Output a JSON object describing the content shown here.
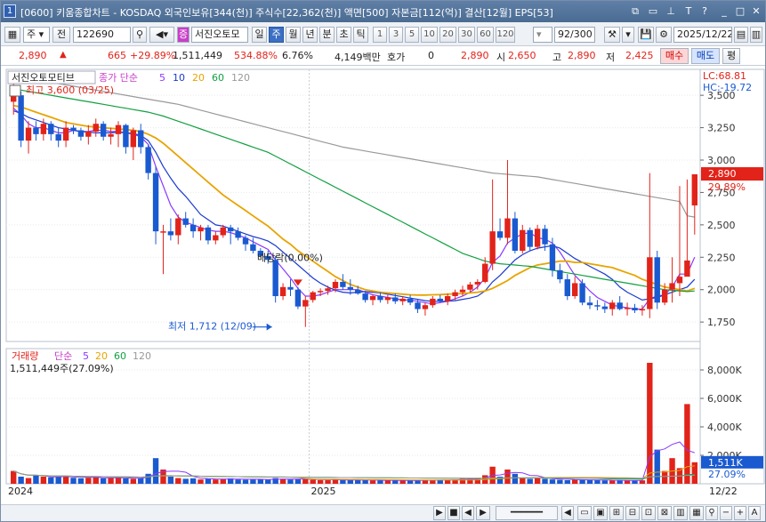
{
  "window": {
    "number": "1",
    "title": "[0600] 키움종합차트 - KOSDAQ 외국인보유[344(천)] 주식수[22,362(천)] 액면[500] 자본금[112(억)] 결산[12월] EPS[53]"
  },
  "toolbar": {
    "type_select": "주",
    "prev_label": "전",
    "code": "122690",
    "name": "서진오토모",
    "period_buttons": [
      "일",
      "주",
      "월",
      "년",
      "분",
      "초",
      "틱"
    ],
    "selected_period": "주",
    "num_buttons": [
      "1",
      "3",
      "5",
      "10",
      "20",
      "30",
      "60",
      "120"
    ],
    "count": "92/300",
    "date": "2025/12/22"
  },
  "pricebar": {
    "price": "2,890",
    "change": "665",
    "change_pct": "+29.89%",
    "volume": "1,511,449",
    "vol_pct": "534.88%",
    "turnover": "6.76%",
    "amount": "4,149백만",
    "quote_label": "호가",
    "quote_val": "0",
    "quote_price": "2,890",
    "open_label": "시",
    "open": "2,650",
    "high_label": "고",
    "high": "2,890",
    "low_label": "저",
    "low": "2,425",
    "buy_label": "매수",
    "sell_label": "매도",
    "eval_label": "평"
  },
  "price_panel": {
    "name": "서진오토모티브",
    "ma_title": "종가 단순",
    "lc": "LC:68.81",
    "hc": "HC:-19.72",
    "max_label": "최고 3,600 (03/25)",
    "min_label": "최저 1,712 (12/09)",
    "dividend_label": "배당락(0.00%)",
    "cur_price_label": "2,890",
    "cur_pct_label": "29.89%"
  },
  "volume_panel": {
    "title": "거래량",
    "ma_title": "단순",
    "value_label": "1,511,449주(27.09%)",
    "cur_label": "1,511K",
    "cur_pct": "27.09%"
  },
  "ma_periods": [
    {
      "period": "5",
      "color": "#8a3aff"
    },
    {
      "period": "10",
      "color": "#1a3ad0"
    },
    {
      "period": "20",
      "color": "#e8a400"
    },
    {
      "period": "60",
      "color": "#11a040"
    },
    {
      "period": "120",
      "color": "#999999"
    }
  ],
  "colors": {
    "up": "#e2231a",
    "down": "#1a5ad0",
    "accent": "#3a6fc4"
  },
  "chart_data": {
    "type": "candlestick",
    "price_ylim": [
      1600,
      3700
    ],
    "price_ticks": [
      "3,500",
      "3,250",
      "3,000",
      "2,750",
      "2,500",
      "2,250",
      "2,000",
      "1,750"
    ],
    "volume_ylim": [
      0,
      9000
    ],
    "volume_ticks": [
      "8,000K",
      "6,000K",
      "4,000K",
      "2,000K"
    ],
    "x_labels": [
      "2024",
      "2025",
      "12/22"
    ],
    "candles": [
      [
        3450,
        3600,
        3350,
        3500
      ],
      [
        3500,
        3530,
        3100,
        3150
      ],
      [
        3150,
        3300,
        3050,
        3250
      ],
      [
        3250,
        3300,
        3150,
        3200
      ],
      [
        3200,
        3320,
        3150,
        3280
      ],
      [
        3280,
        3300,
        3150,
        3200
      ],
      [
        3200,
        3250,
        3100,
        3150
      ],
      [
        3150,
        3300,
        3100,
        3250
      ],
      [
        3250,
        3270,
        3200,
        3230
      ],
      [
        3230,
        3250,
        3150,
        3180
      ],
      [
        3180,
        3270,
        3120,
        3220
      ],
      [
        3220,
        3320,
        3180,
        3280
      ],
      [
        3280,
        3300,
        3150,
        3180
      ],
      [
        3180,
        3250,
        3120,
        3200
      ],
      [
        3200,
        3300,
        3100,
        3270
      ],
      [
        3270,
        3280,
        3050,
        3100
      ],
      [
        3100,
        3250,
        3000,
        3230
      ],
      [
        3230,
        3280,
        3050,
        3100
      ],
      [
        3100,
        3120,
        2850,
        2900
      ],
      [
        2900,
        2950,
        2350,
        2450
      ],
      [
        2450,
        2500,
        2120,
        2450
      ],
      [
        2450,
        2550,
        2380,
        2420
      ],
      [
        2420,
        2580,
        2350,
        2550
      ],
      [
        2550,
        2600,
        2480,
        2500
      ],
      [
        2500,
        2550,
        2400,
        2450
      ],
      [
        2450,
        2500,
        2380,
        2480
      ],
      [
        2480,
        2500,
        2350,
        2380
      ],
      [
        2380,
        2450,
        2350,
        2420
      ],
      [
        2420,
        2500,
        2400,
        2480
      ],
      [
        2480,
        2500,
        2350,
        2450
      ],
      [
        2450,
        2480,
        2380,
        2400
      ],
      [
        2400,
        2420,
        2300,
        2350
      ],
      [
        2350,
        2400,
        2280,
        2300
      ],
      [
        2300,
        2320,
        2250,
        2260
      ],
      [
        2260,
        2300,
        2200,
        2230
      ],
      [
        2230,
        2260,
        1900,
        1950
      ],
      [
        1950,
        2050,
        1920,
        2020
      ],
      [
        2020,
        2080,
        1950,
        2000
      ],
      [
        2000,
        2020,
        1850,
        1870
      ],
      [
        1870,
        1950,
        1712,
        1920
      ],
      [
        1920,
        1990,
        1900,
        1980
      ],
      [
        1980,
        2010,
        1950,
        1990
      ],
      [
        1990,
        2030,
        1960,
        2010
      ],
      [
        2010,
        2080,
        1980,
        2060
      ],
      [
        2060,
        2120,
        2000,
        2020
      ],
      [
        2020,
        2080,
        1960,
        2000
      ],
      [
        2000,
        2030,
        1960,
        1970
      ],
      [
        1970,
        1990,
        1900,
        1920
      ],
      [
        1920,
        1960,
        1880,
        1950
      ],
      [
        1950,
        1980,
        1900,
        1920
      ],
      [
        1920,
        1960,
        1890,
        1940
      ],
      [
        1940,
        1970,
        1890,
        1910
      ],
      [
        1910,
        1950,
        1880,
        1930
      ],
      [
        1930,
        1960,
        1880,
        1900
      ],
      [
        1900,
        1920,
        1820,
        1850
      ],
      [
        1850,
        1900,
        1800,
        1880
      ],
      [
        1880,
        1950,
        1860,
        1930
      ],
      [
        1930,
        1960,
        1900,
        1910
      ],
      [
        1910,
        1970,
        1880,
        1950
      ],
      [
        1950,
        2000,
        1920,
        1980
      ],
      [
        1980,
        2030,
        1950,
        2000
      ],
      [
        2000,
        2060,
        1980,
        2040
      ],
      [
        2040,
        2080,
        2000,
        2060
      ],
      [
        2060,
        2250,
        2050,
        2200
      ],
      [
        2200,
        2850,
        2150,
        2450
      ],
      [
        2450,
        2550,
        2380,
        2400
      ],
      [
        2400,
        3000,
        2350,
        2550
      ],
      [
        2550,
        2600,
        2280,
        2300
      ],
      [
        2300,
        2500,
        2280,
        2460
      ],
      [
        2460,
        2480,
        2300,
        2330
      ],
      [
        2330,
        2500,
        2310,
        2470
      ],
      [
        2470,
        2500,
        2300,
        2350
      ],
      [
        2350,
        2400,
        2100,
        2150
      ],
      [
        2150,
        2200,
        2050,
        2080
      ],
      [
        2080,
        2120,
        1920,
        1950
      ],
      [
        1950,
        2100,
        1930,
        2050
      ],
      [
        2050,
        2080,
        1880,
        1900
      ],
      [
        1900,
        1950,
        1850,
        1880
      ],
      [
        1880,
        1920,
        1840,
        1870
      ],
      [
        1870,
        1900,
        1820,
        1850
      ],
      [
        1850,
        1920,
        1800,
        1900
      ],
      [
        1900,
        1950,
        1840,
        1850
      ],
      [
        1850,
        1900,
        1800,
        1860
      ],
      [
        1860,
        1890,
        1820,
        1840
      ],
      [
        1840,
        1880,
        1800,
        1850
      ],
      [
        1850,
        2900,
        1780,
        2250
      ],
      [
        2250,
        2300,
        1850,
        1900
      ],
      [
        1900,
        2050,
        1880,
        2000
      ],
      [
        2000,
        2250,
        1900,
        2050
      ],
      [
        2050,
        2800,
        1950,
        2100
      ],
      [
        2100,
        2850,
        2150,
        2225
      ],
      [
        2650,
        2890,
        2425,
        2890
      ]
    ],
    "volumes": [
      900,
      500,
      400,
      600,
      500,
      450,
      480,
      550,
      420,
      380,
      420,
      500,
      380,
      400,
      450,
      380,
      350,
      400,
      700,
      1800,
      1000,
      500,
      400,
      350,
      380,
      300,
      350,
      300,
      320,
      380,
      300,
      280,
      300,
      320,
      280,
      400,
      350,
      300,
      320,
      350,
      280,
      250,
      260,
      300,
      280,
      260,
      250,
      280,
      240,
      220,
      230,
      250,
      220,
      240,
      260,
      250,
      270,
      280,
      260,
      300,
      350,
      380,
      400,
      600,
      1200,
      500,
      1000,
      700,
      400,
      350,
      400,
      350,
      300,
      280,
      250,
      300,
      280,
      260,
      250,
      240,
      230,
      250,
      230,
      220,
      240,
      8500,
      2400,
      900,
      1800,
      1100,
      5600,
      1511
    ],
    "ma_lines": {
      "ma5": [
        3400,
        3350,
        3280,
        3250,
        3250,
        3230,
        3210,
        3210,
        3230,
        3220,
        3220,
        3230,
        3230,
        3220,
        3220,
        3210,
        3200,
        3180,
        3120,
        2950,
        2800,
        2650,
        2560,
        2520,
        2500,
        2480,
        2460,
        2450,
        2450,
        2440,
        2420,
        2400,
        2370,
        2340,
        2310,
        2230,
        2160,
        2090,
        2010,
        1950,
        1950,
        1960,
        1980,
        2000,
        2000,
        2000,
        2000,
        1980,
        1960,
        1950,
        1940,
        1930,
        1920,
        1920,
        1910,
        1900,
        1890,
        1900,
        1910,
        1930,
        1950,
        1980,
        2020,
        2090,
        2210,
        2260,
        2360,
        2400,
        2430,
        2440,
        2400,
        2390,
        2360,
        2290,
        2200,
        2110,
        2050,
        1990,
        1940,
        1910,
        1880,
        1870,
        1860,
        1850,
        1850,
        1930,
        1950,
        1960,
        2020,
        2120,
        2120,
        2250
      ],
      "ma10": [
        3380,
        3360,
        3330,
        3310,
        3290,
        3270,
        3250,
        3240,
        3230,
        3220,
        3215,
        3210,
        3210,
        3210,
        3215,
        3210,
        3205,
        3190,
        3150,
        3060,
        2950,
        2860,
        2780,
        2720,
        2650,
        2580,
        2540,
        2500,
        2490,
        2470,
        2450,
        2430,
        2410,
        2395,
        2375,
        2340,
        2290,
        2240,
        2190,
        2140,
        2090,
        2050,
        2020,
        1995,
        1980,
        1975,
        1980,
        1985,
        1980,
        1975,
        1965,
        1955,
        1945,
        1935,
        1925,
        1915,
        1910,
        1910,
        1910,
        1915,
        1925,
        1935,
        1950,
        1990,
        2060,
        2110,
        2170,
        2230,
        2270,
        2300,
        2320,
        2330,
        2340,
        2320,
        2280,
        2240,
        2210,
        2180,
        2150,
        2120,
        2080,
        2020,
        1980,
        1950,
        1920,
        1930,
        1940,
        1960,
        1980,
        2000,
        2020,
        2080
      ],
      "ma20": [
        3420,
        3410,
        3390,
        3370,
        3350,
        3330,
        3310,
        3290,
        3280,
        3270,
        3260,
        3255,
        3250,
        3245,
        3240,
        3235,
        3230,
        3220,
        3200,
        3170,
        3130,
        3080,
        3030,
        2980,
        2930,
        2880,
        2830,
        2780,
        2730,
        2690,
        2650,
        2610,
        2570,
        2530,
        2490,
        2440,
        2390,
        2350,
        2300,
        2260,
        2220,
        2180,
        2140,
        2100,
        2070,
        2040,
        2020,
        2000,
        1990,
        1980,
        1975,
        1970,
        1965,
        1960,
        1958,
        1958,
        1960,
        1962,
        1965,
        1968,
        1970,
        1975,
        1980,
        1990,
        2010,
        2040,
        2070,
        2110,
        2140,
        2170,
        2190,
        2200,
        2210,
        2220,
        2220,
        2210,
        2210,
        2200,
        2190,
        2180,
        2170,
        2150,
        2130,
        2110,
        2080,
        2060,
        2040,
        2020,
        2010,
        2000,
        1990,
        2010
      ],
      "ma60": [
        3550,
        3540,
        3530,
        3520,
        3510,
        3500,
        3490,
        3480,
        3470,
        3460,
        3450,
        3440,
        3430,
        3420,
        3410,
        3400,
        3390,
        3380,
        3370,
        3355,
        3340,
        3320,
        3300,
        3280,
        3260,
        3240,
        3220,
        3200,
        3180,
        3160,
        3140,
        3120,
        3100,
        3080,
        3060,
        3030,
        3000,
        2970,
        2940,
        2910,
        2880,
        2850,
        2820,
        2790,
        2760,
        2730,
        2700,
        2670,
        2640,
        2610,
        2580,
        2550,
        2520,
        2490,
        2460,
        2430,
        2400,
        2370,
        2340,
        2310,
        2280,
        2260,
        2240,
        2220,
        2210,
        2200,
        2195,
        2190,
        2185,
        2180,
        2170,
        2160,
        2150,
        2140,
        2130,
        2120,
        2110,
        2100,
        2090,
        2080,
        2070,
        2060,
        2050,
        2040,
        2030,
        2020,
        2010,
        2000,
        1995,
        1990,
        1985,
        1990
      ],
      "ma120": [
        3650,
        3640,
        3630,
        3620,
        3610,
        3600,
        3590,
        3580,
        3570,
        3560,
        3550,
        3540,
        3530,
        3520,
        3510,
        3500,
        3490,
        3480,
        3470,
        3460,
        3450,
        3440,
        3430,
        3415,
        3400,
        3385,
        3370,
        3355,
        3340,
        3325,
        3310,
        3295,
        3280,
        3265,
        3250,
        3235,
        3220,
        3205,
        3190,
        3175,
        3160,
        3145,
        3130,
        3115,
        3100,
        3090,
        3080,
        3070,
        3060,
        3050,
        3040,
        3030,
        3020,
        3010,
        3000,
        2990,
        2980,
        2970,
        2960,
        2950,
        2940,
        2930,
        2920,
        2910,
        2900,
        2895,
        2890,
        2885,
        2880,
        2875,
        2870,
        2860,
        2850,
        2840,
        2830,
        2820,
        2810,
        2800,
        2790,
        2780,
        2770,
        2760,
        2750,
        2740,
        2730,
        2720,
        2710,
        2700,
        2690,
        2680,
        2570,
        2560
      ]
    }
  }
}
